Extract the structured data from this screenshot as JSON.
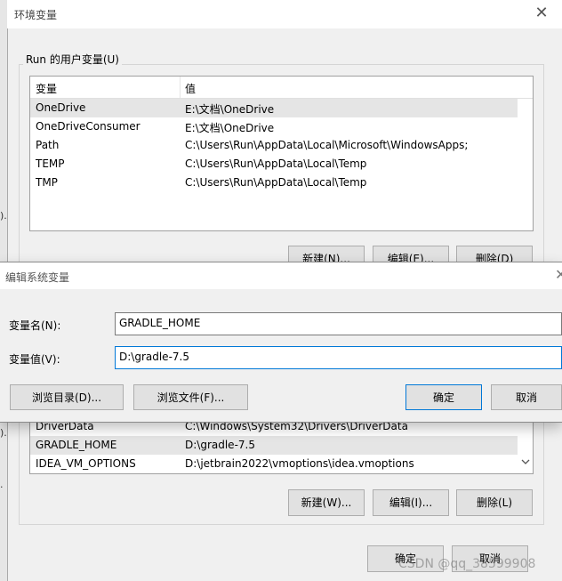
{
  "env_dialog": {
    "title": "环境变量",
    "close_glyph": "✕",
    "user_group_label": "Run 的用户变量(U)",
    "user_table": {
      "headers": [
        "变量",
        "值"
      ],
      "rows": [
        {
          "name": "OneDrive",
          "value": "E:\\文档\\OneDrive"
        },
        {
          "name": "OneDriveConsumer",
          "value": "E:\\文档\\OneDrive"
        },
        {
          "name": "Path",
          "value": "C:\\Users\\Run\\AppData\\Local\\Microsoft\\WindowsApps;"
        },
        {
          "name": "TEMP",
          "value": "C:\\Users\\Run\\AppData\\Local\\Temp"
        },
        {
          "name": "TMP",
          "value": "C:\\Users\\Run\\AppData\\Local\\Temp"
        }
      ]
    },
    "user_buttons": {
      "new": "新建(N)...",
      "edit": "编辑(E)...",
      "delete": "删除(D)"
    },
    "system_table": {
      "rows": [
        {
          "name": "DriverData",
          "value": "C:\\Windows\\System32\\Drivers\\DriverData"
        },
        {
          "name": "GRADLE_HOME",
          "value": "D:\\gradle-7.5"
        },
        {
          "name": "IDEA_VM_OPTIONS",
          "value": "D:\\jetbrain2022\\vmoptions\\idea.vmoptions"
        }
      ]
    },
    "system_buttons": {
      "new": "新建(W)...",
      "edit": "编辑(I)...",
      "delete": "删除(L)"
    },
    "ok": "确定",
    "cancel": "取消"
  },
  "edit_dialog": {
    "title": "编辑系统变量",
    "close_glyph": "✕",
    "name_label": "变量名(N):",
    "name_value": "GRADLE_HOME",
    "value_label": "变量值(V):",
    "value_value": "D:\\gradle-7.5",
    "browse_dir": "浏览目录(D)...",
    "browse_file": "浏览文件(F)...",
    "ok": "确定",
    "cancel": "取消"
  },
  "background_marks": [
    ").",
    ").",
    "."
  ],
  "watermark": "CSDN @qq_38599908",
  "icons": {
    "scroll_down": "chevron-down-icon"
  }
}
